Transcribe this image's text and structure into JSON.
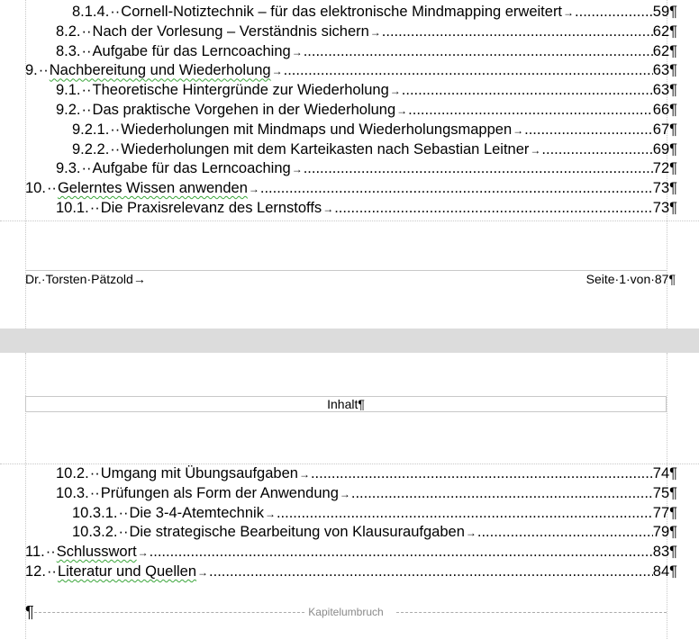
{
  "page1": {
    "toc": [
      {
        "number": "8.1.4.",
        "title": "Cornell-Notiztechnik – für das elektronische Mindmapping erweitert",
        "page": "59"
      },
      {
        "number": "8.2.",
        "title": "Nach der Vorlesung – Verständnis sichern",
        "page": "62"
      },
      {
        "number": "8.3.",
        "title": "Aufgabe für das Lerncoaching",
        "page": "62"
      },
      {
        "number": "9.",
        "title": "Nachbereitung und Wiederholung",
        "page": "63"
      },
      {
        "number": "9.1.",
        "title": "Theoretische Hintergründe zur Wiederholung",
        "page": "63"
      },
      {
        "number": "9.2.",
        "title": "Das praktische Vorgehen in der Wiederholung",
        "page": "66"
      },
      {
        "number": "9.2.1.",
        "title": "Wiederholungen mit Mindmaps und Wiederholungsmappen",
        "page": "67"
      },
      {
        "number": "9.2.2.",
        "title": "Wiederholungen mit dem Karteikasten nach Sebastian Leitner",
        "page": "69"
      },
      {
        "number": "9.3.",
        "title": "Aufgabe für das Lerncoaching",
        "page": "72"
      },
      {
        "number": "10.",
        "title": "Gelerntes Wissen anwenden",
        "page": "73"
      },
      {
        "number": "10.1.",
        "title": "Die Praxisrelevanz des Lernstoffs",
        "page": "73"
      }
    ],
    "footer_left": "Dr.·Torsten·Pätzold→",
    "footer_right": "Seite·1·von·87¶"
  },
  "page2": {
    "header": "Inhalt¶",
    "toc": [
      {
        "number": "10.2.",
        "title": "Umgang mit Übungsaufgaben",
        "page": "74"
      },
      {
        "number": "10.3.",
        "title": "Prüfungen als Form der Anwendung",
        "page": "75"
      },
      {
        "number": "10.3.1.",
        "title": "Die 3-4-Atemtechnik",
        "page": "77"
      },
      {
        "number": "10.3.2.",
        "title": "Die strategische Bearbeitung von Klausuraufgaben",
        "page": "79"
      },
      {
        "number": "11.",
        "title": "Schlusswort",
        "page": "83"
      },
      {
        "number": "12.",
        "title": "Literatur und Quellen",
        "page": "84"
      }
    ],
    "pilcrow": "¶",
    "page_break_label": "Kapitelumbruch"
  }
}
